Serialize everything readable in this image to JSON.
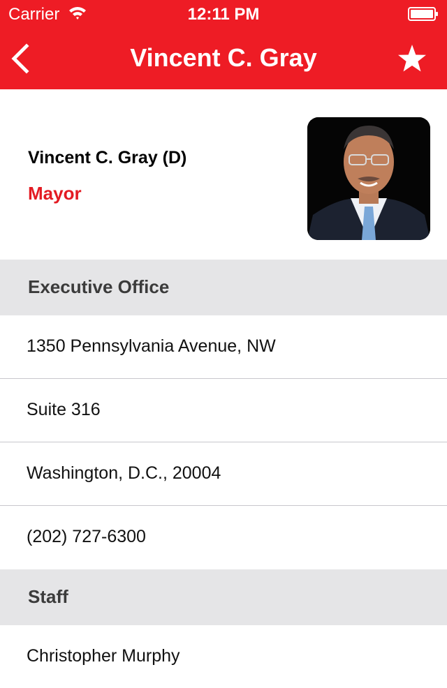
{
  "status_bar": {
    "carrier": "Carrier",
    "time": "12:11 PM"
  },
  "nav": {
    "title": "Vincent C. Gray",
    "back_icon": "chevron-left-icon",
    "favorite_icon": "star-icon"
  },
  "profile": {
    "name": "Vincent C. Gray (D)",
    "role": "Mayor"
  },
  "sections": {
    "office": {
      "header": "Executive Office",
      "rows": [
        "1350 Pennsylvania Avenue, NW",
        "Suite 316",
        "Washington, D.C.,  20004",
        "(202) 727-6300"
      ]
    },
    "staff": {
      "header": "Staff",
      "rows": [
        "Christopher Murphy"
      ]
    }
  },
  "colors": {
    "brand_red": "#ee1c25",
    "role_red": "#e31b23",
    "section_gray": "#e5e5e7"
  }
}
